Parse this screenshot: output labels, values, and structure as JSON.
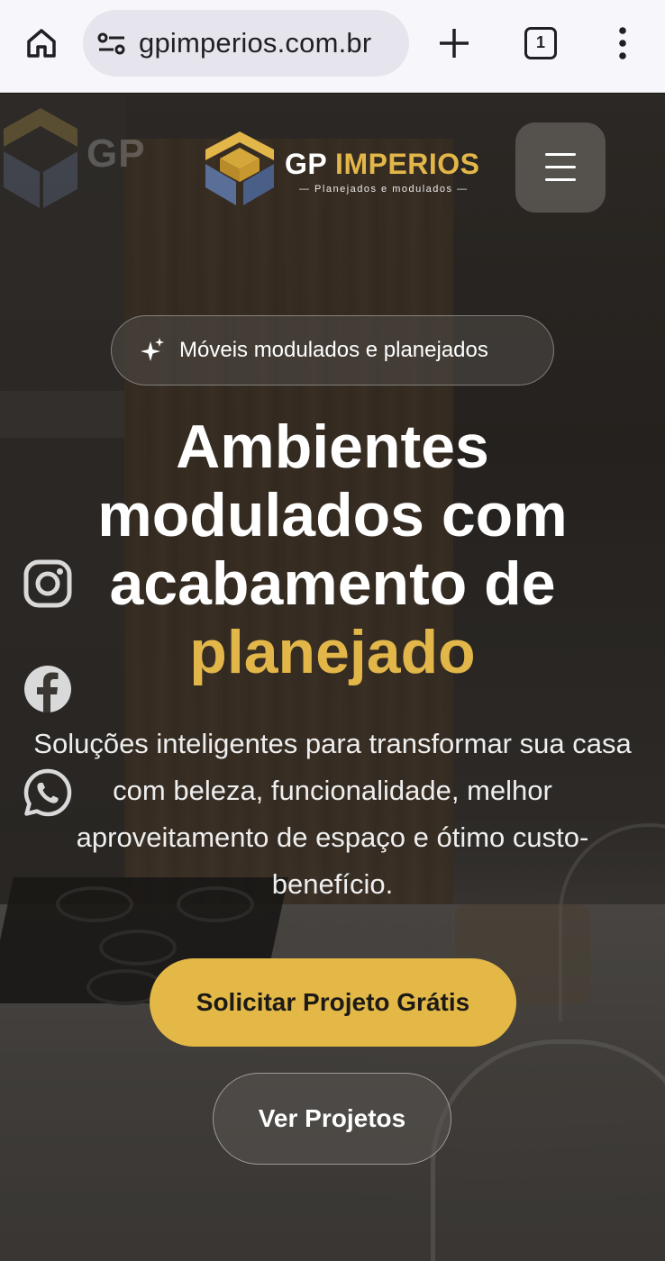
{
  "browser": {
    "url": "gpimperios.com.br",
    "tab_count": "1",
    "icons": {
      "home": "home-icon",
      "site_info": "tune-icon",
      "new_tab": "plus-icon",
      "menu": "more-vert-icon"
    }
  },
  "site": {
    "logo": {
      "name_part1": "GP",
      "name_part2": "IMPERIOS",
      "tagline": "— Planejados e modulados —"
    },
    "menu_icon": "hamburger-icon",
    "badge": {
      "icon": "sparkles-icon",
      "text": "Móveis modulados e planejados"
    },
    "headline": {
      "line1": "Ambientes",
      "line2": "modulados com",
      "line3": "acabamento de",
      "highlight": "planejado"
    },
    "subtext": "Soluções inteligentes para transformar sua casa com beleza, funcionalidade, melhor aproveitamento de espaço e ótimo custo-benefício.",
    "social": [
      "instagram-icon",
      "facebook-icon",
      "whatsapp-icon"
    ],
    "cta_primary": "Solicitar Projeto Grátis",
    "cta_secondary": "Ver Projetos",
    "colors": {
      "accent": "#e3b847",
      "text": "#ffffff"
    }
  }
}
